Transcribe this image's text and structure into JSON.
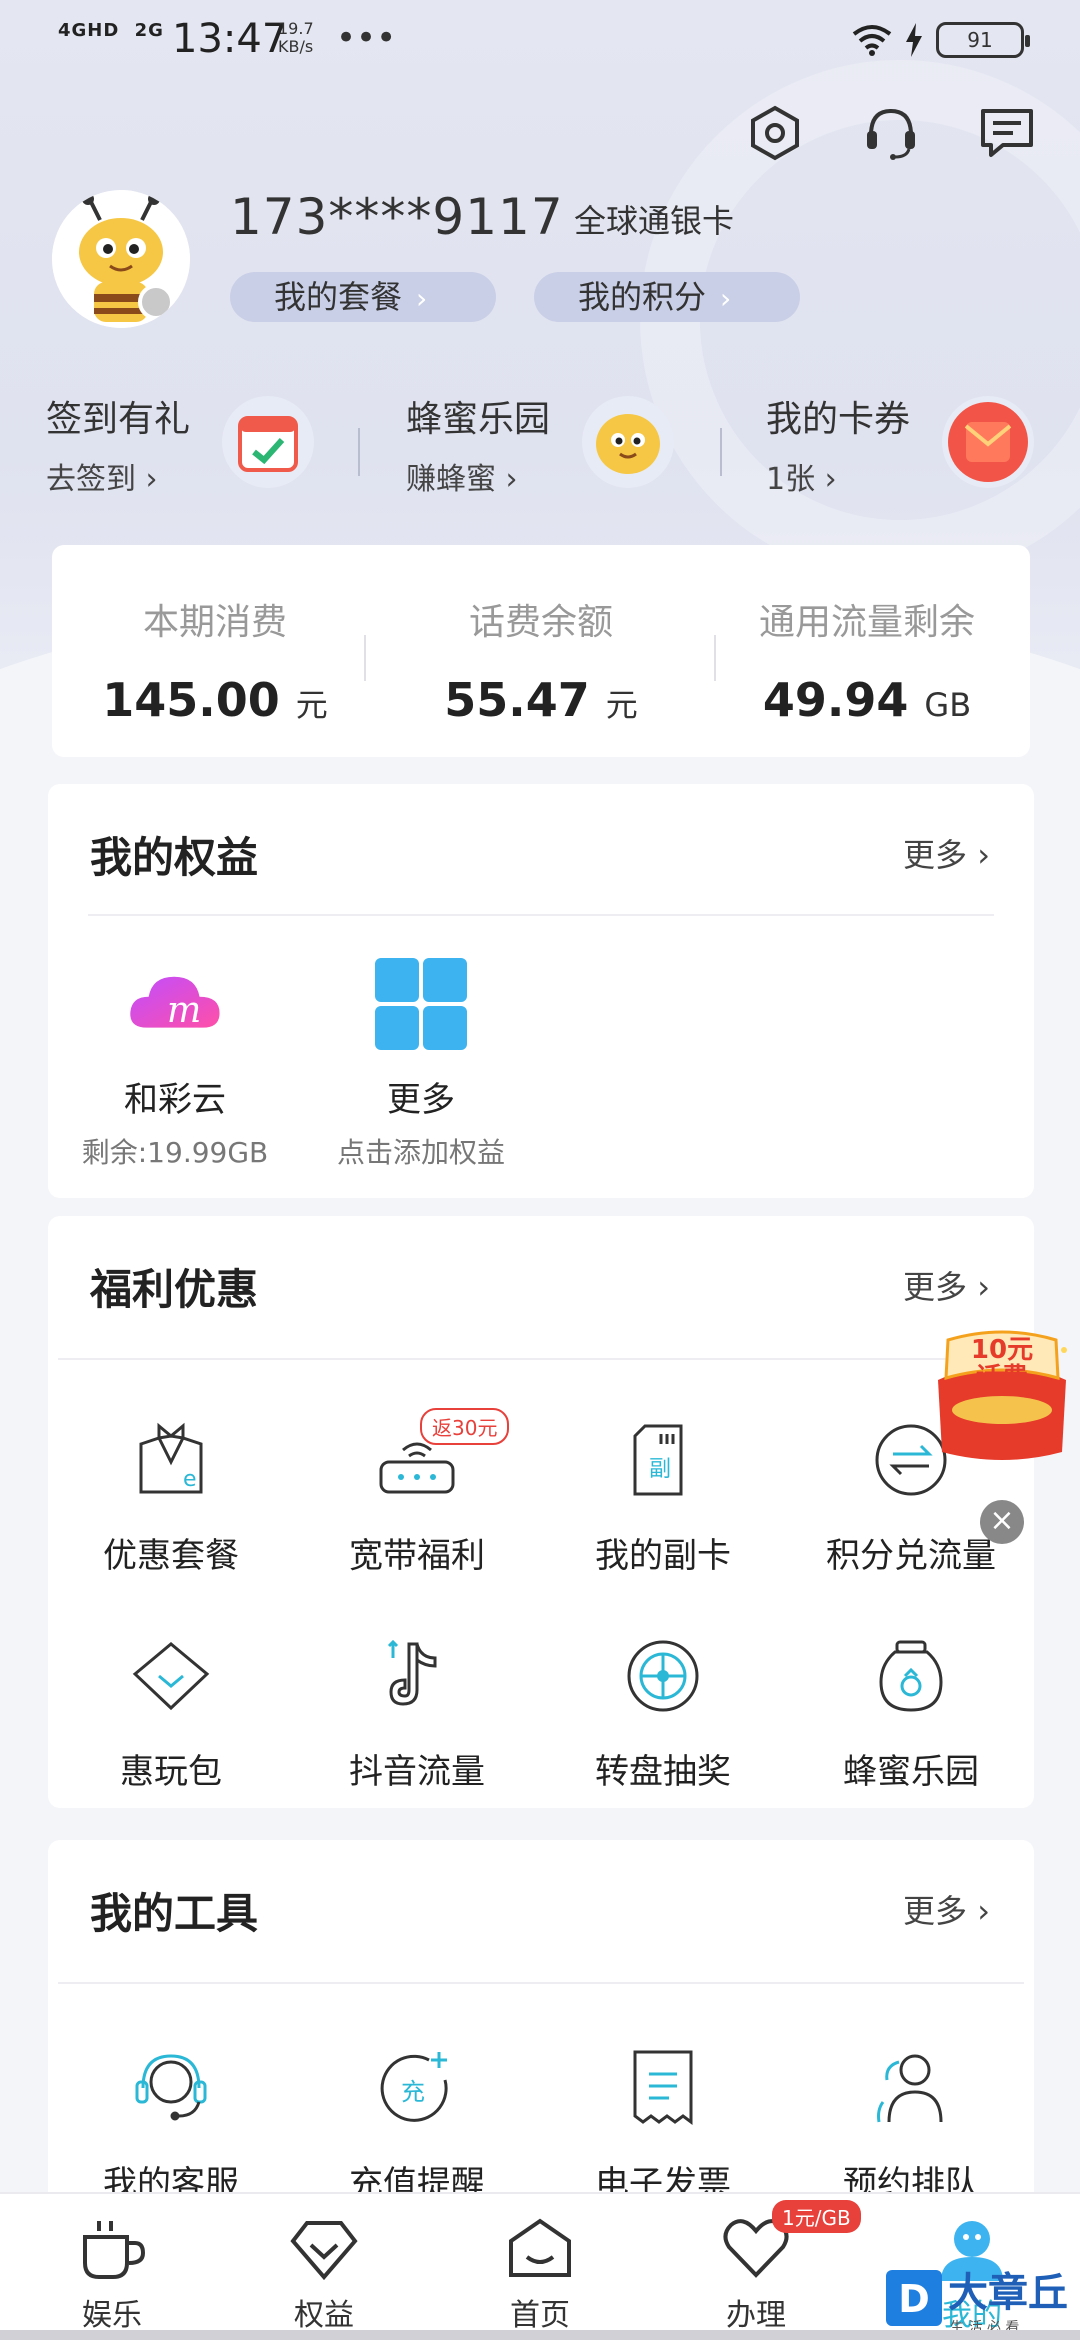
{
  "status_bar": {
    "network_1": "4GHD",
    "network_2": "2G",
    "time": "13:47",
    "speed_value": "19.7",
    "speed_unit": "KB/s",
    "more": "•••",
    "battery": "91"
  },
  "header": {
    "icons": [
      "settings-icon",
      "customer-service-icon",
      "message-icon"
    ]
  },
  "profile": {
    "phone": "173****9117",
    "card_type": "全球通银卡",
    "my_plan": "我的套餐",
    "my_points": "我的积分"
  },
  "quick_links": [
    {
      "title": "签到有礼",
      "sub": "去签到"
    },
    {
      "title": "蜂蜜乐园",
      "sub": "赚蜂蜜"
    },
    {
      "title": "我的卡券",
      "sub": "1张"
    }
  ],
  "balances": [
    {
      "label": "本期消费",
      "value": "145.00",
      "unit": "元"
    },
    {
      "label": "话费余额",
      "value": "55.47",
      "unit": "元"
    },
    {
      "label": "通用流量剩余",
      "value": "49.94",
      "unit": "GB"
    }
  ],
  "rights": {
    "title": "我的权益",
    "more": "更多",
    "items": [
      {
        "label": "和彩云",
        "sub": "剩余:19.99GB"
      },
      {
        "label": "更多",
        "sub": "点击添加权益"
      }
    ]
  },
  "welfare": {
    "title": "福利优惠",
    "more": "更多",
    "badge": "返30元",
    "items": [
      {
        "label": "优惠套餐"
      },
      {
        "label": "宽带福利"
      },
      {
        "label": "我的副卡"
      },
      {
        "label": "积分兑流量"
      },
      {
        "label": "惠玩包"
      },
      {
        "label": "抖音流量"
      },
      {
        "label": "转盘抽奖"
      },
      {
        "label": "蜂蜜乐园"
      }
    ]
  },
  "tools": {
    "title": "我的工具",
    "more": "更多",
    "items": [
      {
        "label": "我的客服"
      },
      {
        "label": "充值提醒"
      },
      {
        "label": "电子发票"
      },
      {
        "label": "预约排队"
      }
    ]
  },
  "promo": {
    "line1": "10元",
    "line2": "话费",
    "close": "×"
  },
  "bottom_nav": {
    "items": [
      {
        "label": "娱乐"
      },
      {
        "label": "权益"
      },
      {
        "label": "首页"
      },
      {
        "label": "办理"
      },
      {
        "label": "我的"
      }
    ],
    "badge": "1元/GB"
  },
  "watermark": {
    "letter": "D",
    "text": "大章丘",
    "sub": "生 活 必 看"
  },
  "colors": {
    "accent": "#2bb8d6",
    "badge_red": "#e8403a",
    "pill_bg": "#c9cfe6"
  }
}
